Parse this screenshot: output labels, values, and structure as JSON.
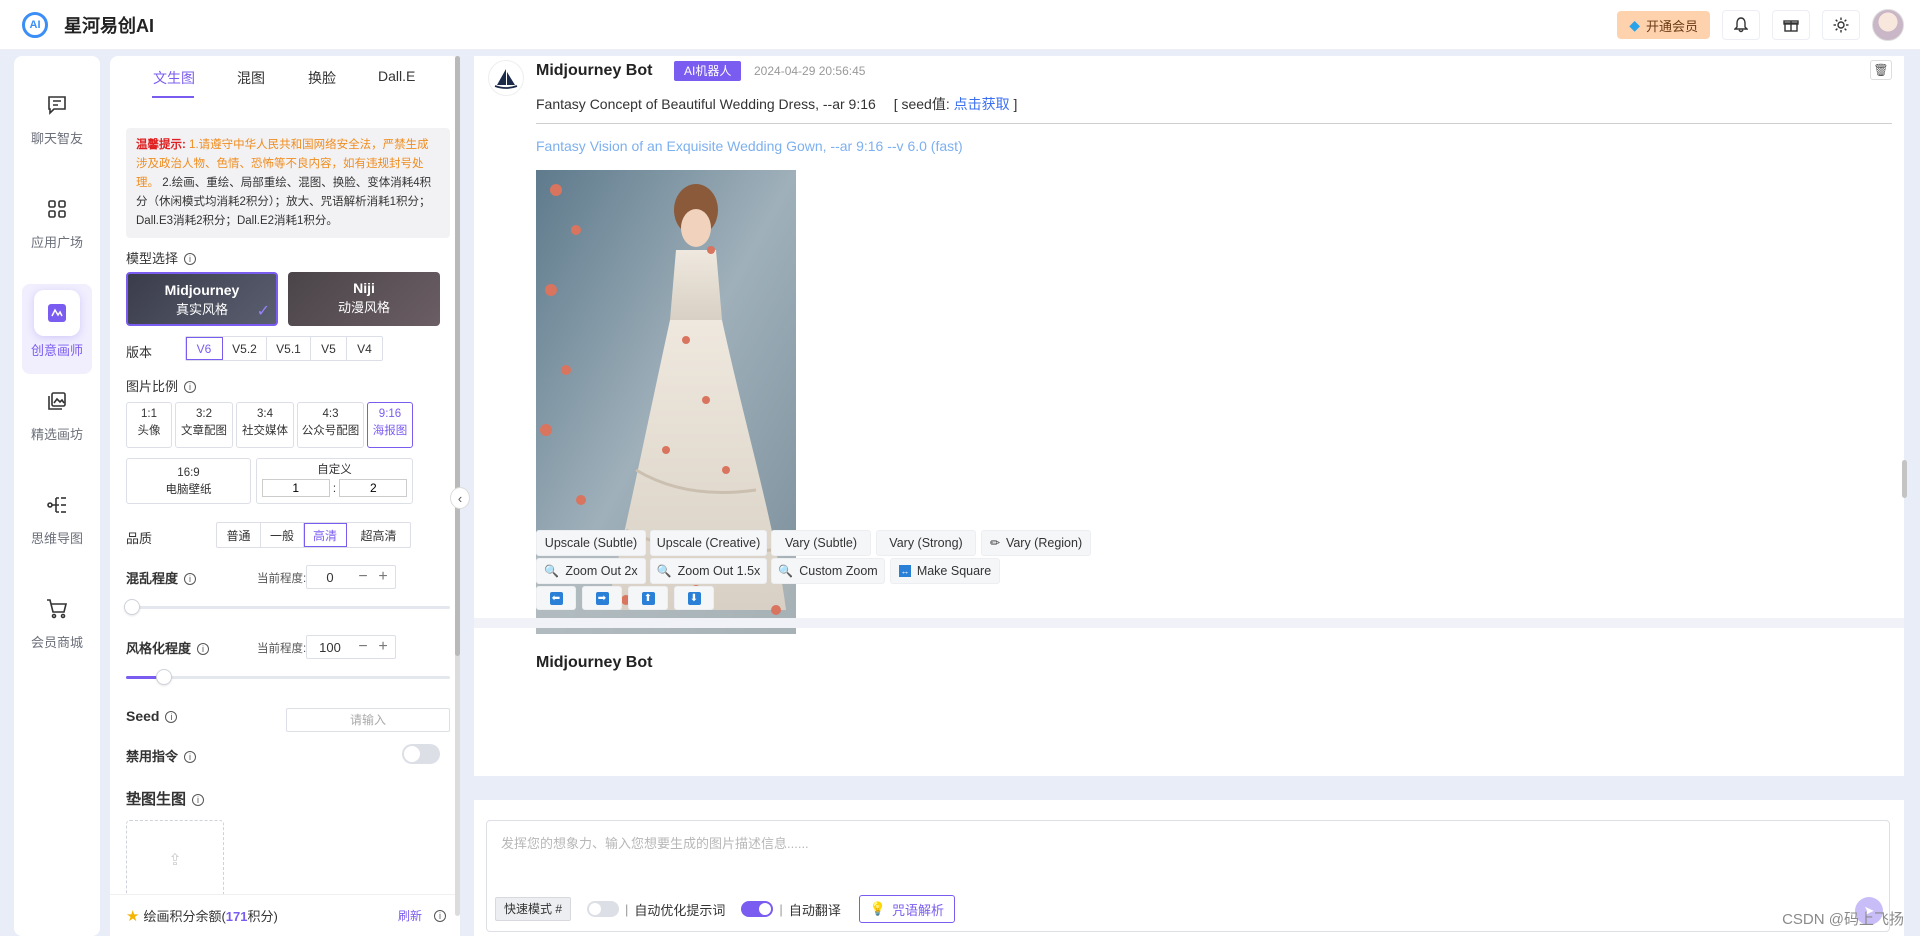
{
  "app": {
    "title": "星河易创AI",
    "logo_text": "AI"
  },
  "header": {
    "vip_label": "开通会员",
    "icons": [
      "bell-icon",
      "gift-icon",
      "sun-icon"
    ]
  },
  "nav": {
    "items": [
      {
        "label": "聊天智友",
        "icon": "chat-icon"
      },
      {
        "label": "应用广场",
        "icon": "grid-icon"
      },
      {
        "label": "创意画师",
        "icon": "paint-icon",
        "active": true
      },
      {
        "label": "精选画坊",
        "icon": "gallery-icon"
      },
      {
        "label": "思维导图",
        "icon": "mindmap-icon"
      },
      {
        "label": "会员商城",
        "icon": "cart-icon"
      }
    ]
  },
  "panel": {
    "tabs": [
      "文生图",
      "混图",
      "换脸",
      "Dall.E"
    ],
    "active_tab": "文生图",
    "notice": {
      "label": "温馨提示:",
      "warn": "1.请遵守中华人民共和国网络安全法，严禁生成涉及政治人物、色情、恐怖等不良内容，如有违规封号处理。",
      "text": "2.绘画、重绘、局部重绘、混图、换脸、变体消耗4积分（休闲模式均消耗2积分）；放大、咒语解析消耗1积分；Dall.E3消耗2积分；Dall.E2消耗1积分。"
    },
    "model": {
      "label": "模型选择",
      "options": [
        {
          "name": "Midjourney",
          "sub": "真实风格"
        },
        {
          "name": "Niji",
          "sub": "动漫风格"
        }
      ]
    },
    "version": {
      "label": "版本",
      "options": [
        "V6",
        "V5.2",
        "V5.1",
        "V5",
        "V4"
      ],
      "selected": "V6"
    },
    "ratio": {
      "label": "图片比例",
      "options": [
        {
          "r": "1:1",
          "d": "头像"
        },
        {
          "r": "3:2",
          "d": "文章配图"
        },
        {
          "r": "3:4",
          "d": "社交媒体"
        },
        {
          "r": "4:3",
          "d": "公众号配图"
        },
        {
          "r": "9:16",
          "d": "海报图"
        }
      ],
      "wide": {
        "r": "16:9",
        "d": "电脑壁纸"
      },
      "custom": {
        "label": "自定义",
        "w": "1",
        "sep": ":",
        "h": "2"
      }
    },
    "quality": {
      "label": "品质",
      "options": [
        "普通",
        "一般",
        "高清",
        "超高清"
      ],
      "selected": "高清"
    },
    "chaos": {
      "label": "混乱程度",
      "current_label": "当前程度:",
      "value": "0",
      "minus": "−",
      "plus": "+",
      "level": 0
    },
    "stylize": {
      "label": "风格化程度",
      "current_label": "当前程度:",
      "value": "100",
      "minus": "−",
      "plus": "+",
      "level": 0.1
    },
    "seed": {
      "label": "Seed",
      "placeholder": "请输入"
    },
    "disable": {
      "label": "禁用指令",
      "on": false
    },
    "image_ref": {
      "label": "垫图生图"
    },
    "credits": {
      "prefix": "绘画积分余额(",
      "value": "171",
      "suffix": "积分)",
      "refresh": "刷新"
    }
  },
  "chat": {
    "message": {
      "bot": "Midjourney Bot",
      "badge": "AI机器人",
      "time": "2024-04-29 20:56:45",
      "prompt": "Fantasy Concept of Beautiful Wedding Dress, --ar 9:16",
      "seed_prefix": "[ seed值:",
      "seed_link": "点击获取",
      "seed_suffix": "]",
      "result": "Fantasy Vision of an Exquisite Wedding Gown, --ar 9:16 --v 6.0  (fast)",
      "actions_row1": [
        "Upscale (Subtle)",
        "Upscale (Creative)",
        "Vary (Subtle)",
        "Vary (Strong)",
        "Vary (Region)"
      ],
      "actions_row2": [
        "Zoom Out 2x",
        "Zoom Out 1.5x",
        "Custom Zoom",
        "Make Square"
      ],
      "arrows": [
        "⬅",
        "➡",
        "⬆",
        "⬇"
      ]
    },
    "next_bot": "Midjourney Bot"
  },
  "composer": {
    "placeholder": "发挥您的想象力、输入您想要生成的图片描述信息......",
    "mode": "快速模式 #",
    "opt1": "自动优化提示词",
    "opt1_on": false,
    "opt2": "自动翻译",
    "opt2_on": true,
    "spell": "咒语解析"
  },
  "watermark": "CSDN @码上飞扬"
}
